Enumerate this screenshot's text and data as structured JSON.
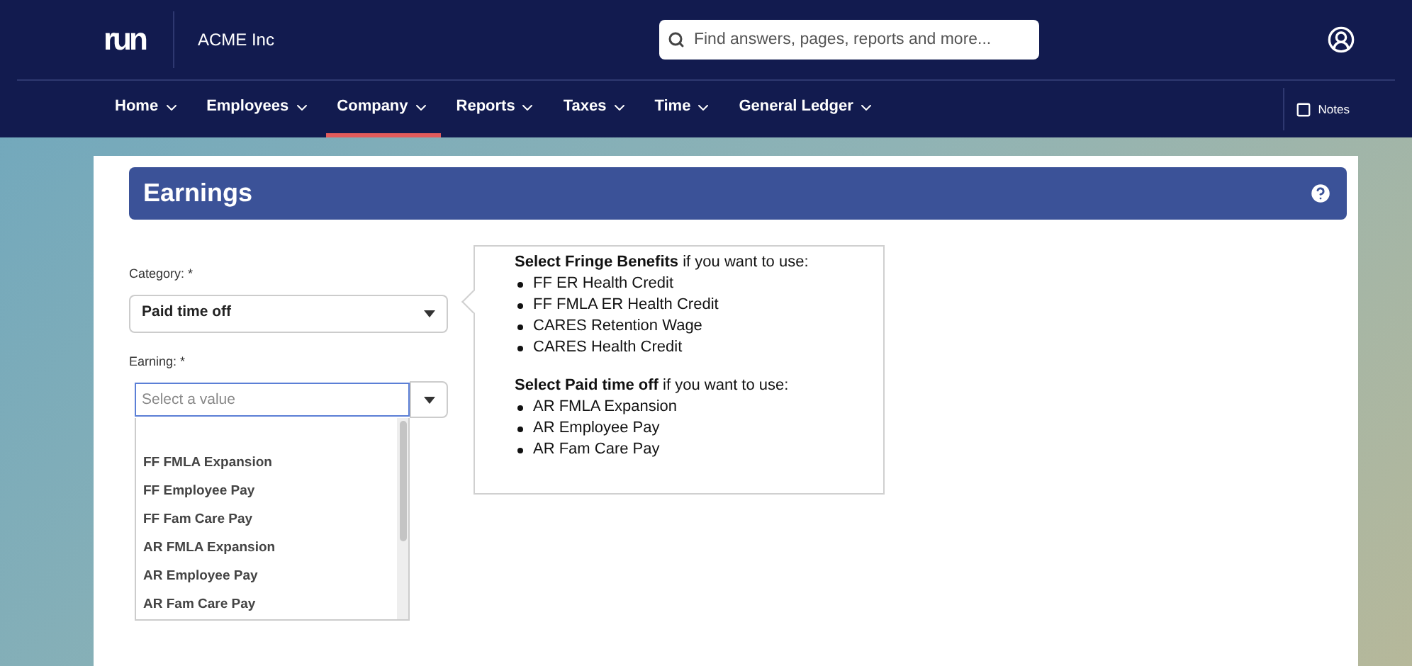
{
  "header": {
    "logo": "run",
    "company": "ACME Inc",
    "search": {
      "placeholder": "Find answers, pages, reports and more..."
    }
  },
  "nav": {
    "items": [
      {
        "label": "Home",
        "selected": false
      },
      {
        "label": "Employees",
        "selected": false
      },
      {
        "label": "Company",
        "selected": true
      },
      {
        "label": "Reports",
        "selected": false
      },
      {
        "label": "Taxes",
        "selected": false
      },
      {
        "label": "Time",
        "selected": false
      },
      {
        "label": "General Ledger",
        "selected": false
      }
    ],
    "notes": "Notes"
  },
  "page": {
    "title": "Earnings",
    "category": {
      "label": "Category: *",
      "value": "Paid time off"
    },
    "earning": {
      "label": "Earning: *",
      "placeholder": "Select a value",
      "expanded": true,
      "options": [
        "FF FMLA Expansion",
        "FF Employee Pay",
        "FF Fam Care Pay",
        "AR FMLA Expansion",
        "AR Employee Pay",
        "AR Fam Care Pay"
      ]
    },
    "tooltip": {
      "sections": [
        {
          "heading": "**Select Fringe Benefits** if you want to use:",
          "items": [
            "FF ER Health Credit",
            "FF FMLA ER Health Credit",
            "CARES Retention Wage",
            "CARES Health Credit"
          ]
        },
        {
          "heading": "**Select Paid time off** if you want to use:",
          "items": [
            "AR FMLA Expansion",
            "AR Employee Pay",
            "AR Fam Care Pay"
          ]
        }
      ]
    }
  }
}
